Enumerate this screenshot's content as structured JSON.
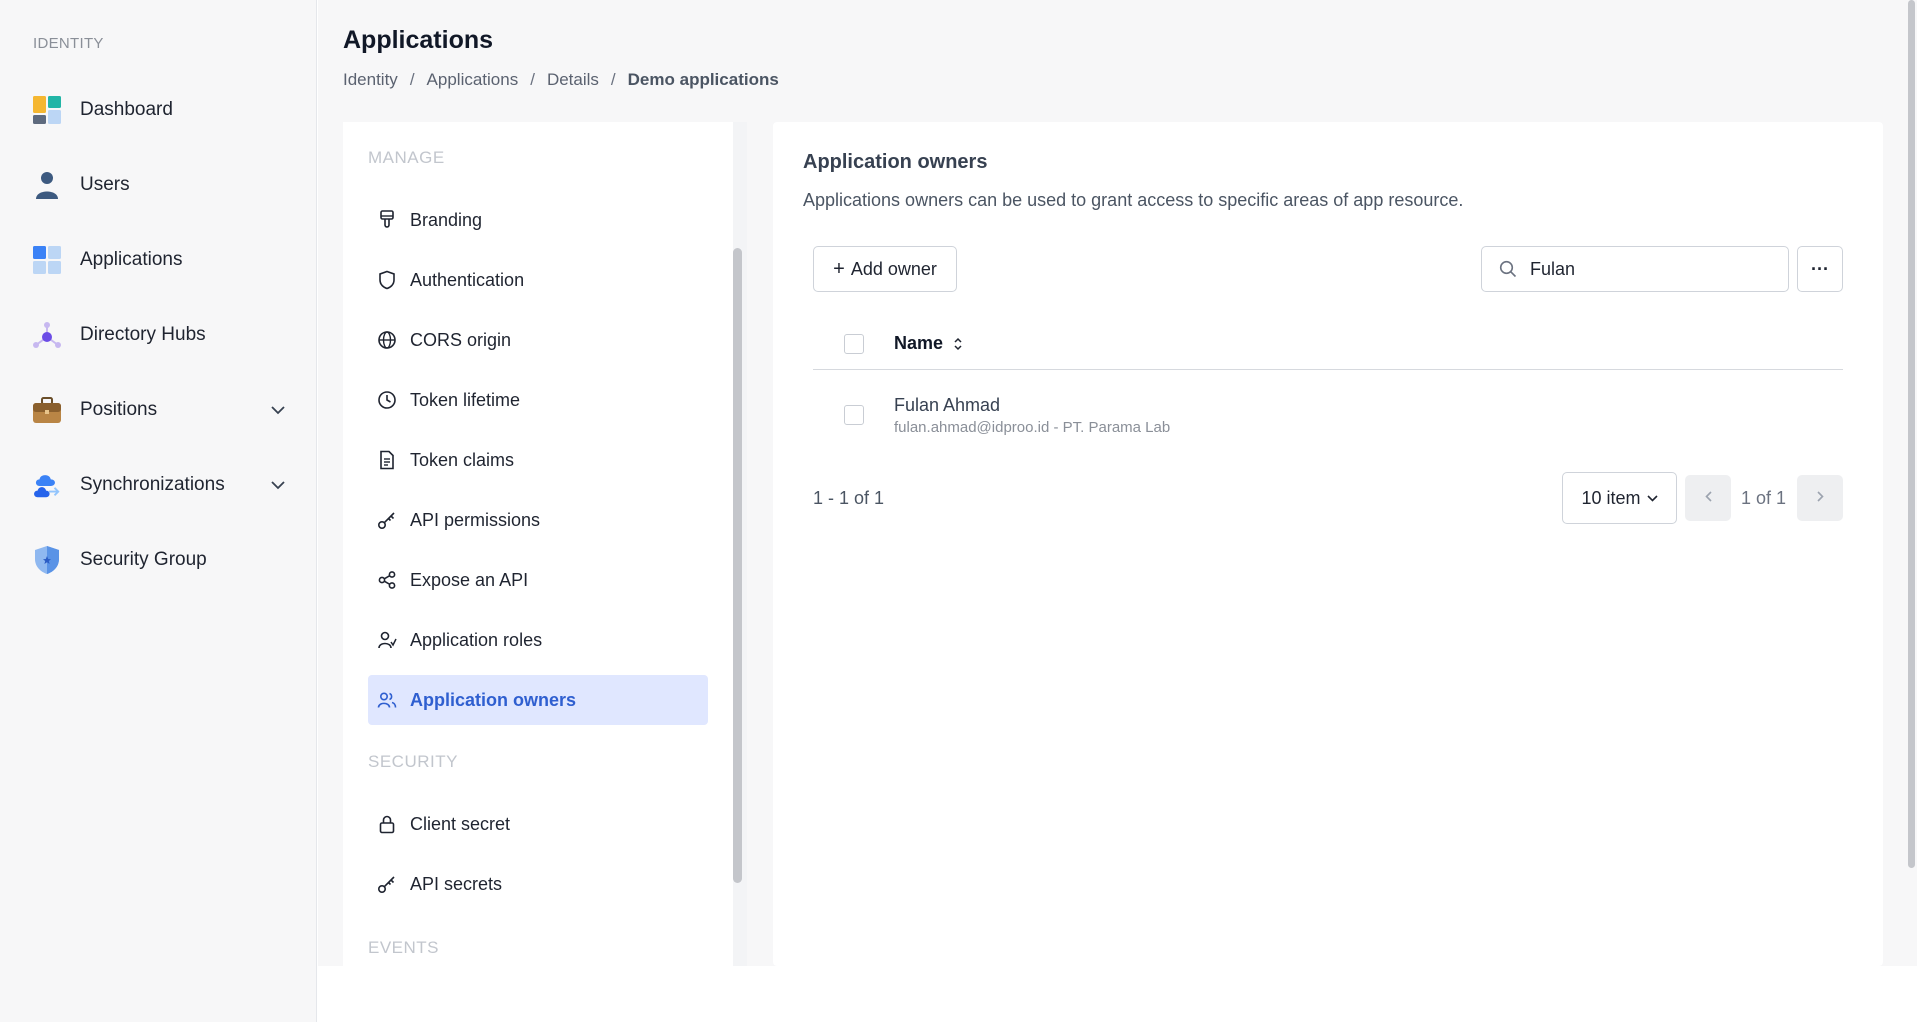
{
  "sidebar": {
    "group_title": "IDENTITY",
    "items": [
      {
        "label": "Dashboard",
        "icon": "dashboard-icon"
      },
      {
        "label": "Users",
        "icon": "user-icon"
      },
      {
        "label": "Applications",
        "icon": "applications-icon"
      },
      {
        "label": "Directory Hubs",
        "icon": "directory-hubs-icon"
      },
      {
        "label": "Positions",
        "icon": "briefcase-icon",
        "expandable": true
      },
      {
        "label": "Synchronizations",
        "icon": "cloud-sync-icon",
        "expandable": true
      },
      {
        "label": "Security Group",
        "icon": "shield-icon"
      }
    ]
  },
  "header": {
    "title": "Applications",
    "breadcrumb": [
      "Identity",
      "Applications",
      "Details",
      "Demo applications"
    ],
    "separator": "/"
  },
  "manage_panel": {
    "sections": [
      {
        "title": "MANAGE",
        "items": [
          {
            "label": "Branding",
            "icon": "brush-icon"
          },
          {
            "label": "Authentication",
            "icon": "shield-outline-icon"
          },
          {
            "label": "CORS origin",
            "icon": "globe-icon"
          },
          {
            "label": "Token lifetime",
            "icon": "clock-icon"
          },
          {
            "label": "Token claims",
            "icon": "document-icon"
          },
          {
            "label": "API permissions",
            "icon": "key-icon"
          },
          {
            "label": "Expose an API",
            "icon": "share-icon"
          },
          {
            "label": "Application roles",
            "icon": "user-role-icon"
          },
          {
            "label": "Application owners",
            "icon": "users-icon",
            "active": true
          }
        ]
      },
      {
        "title": "SECURITY",
        "items": [
          {
            "label": "Client secret",
            "icon": "lock-icon"
          },
          {
            "label": "API secrets",
            "icon": "key-icon"
          }
        ]
      },
      {
        "title": "EVENTS",
        "items": []
      }
    ]
  },
  "owners": {
    "title": "Application owners",
    "description": "Applications owners can be used to grant access to specific areas of app resource.",
    "add_label": "Add owner",
    "search_value": "Fulan",
    "more_label": "···",
    "columns": [
      "Name"
    ],
    "rows": [
      {
        "name": "Fulan Ahmad",
        "detail": "fulan.ahmad@idproo.id - PT. Parama Lab"
      }
    ],
    "range_text": "1 - 1 of 1",
    "page_size": "10 item",
    "page_info": "1 of 1"
  },
  "colors": {
    "accent": "#2f5fd0",
    "active_bg": "#e0e7ff",
    "nav_bg": "#f7f7f8"
  }
}
